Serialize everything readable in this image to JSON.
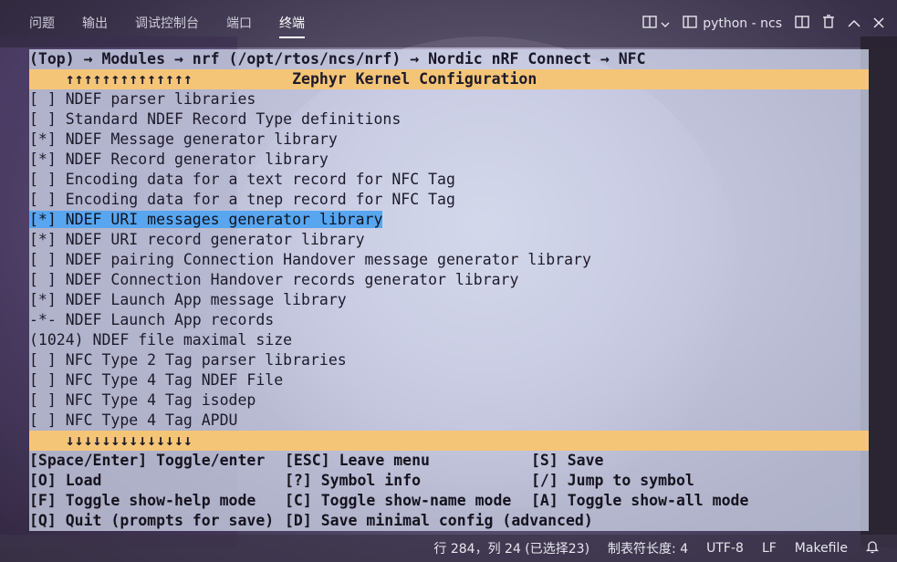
{
  "tabs": [
    "问题",
    "输出",
    "调试控制台",
    "端口",
    "终端"
  ],
  "active_tab_index": 4,
  "terminal_name": "python - ncs",
  "breadcrumb": "(Top) → Modules → nrf (/opt/rtos/ncs/nrf) → Nordic nRF Connect → NFC",
  "title_line": "    ↑↑↑↑↑↑↑↑↑↑↑↑↑↑           Zephyr Kernel Configuration",
  "menu_items": [
    "[ ] NDEF parser libraries",
    "[ ] Standard NDEF Record Type definitions",
    "[*] NDEF Message generator library",
    "[*] NDEF Record generator library",
    "[ ] Encoding data for a text record for NFC Tag",
    "[ ] Encoding data for a tnep record for NFC Tag",
    "[*] NDEF URI messages generator library",
    "[*] NDEF URI record generator library",
    "[ ] NDEF pairing Connection Handover message generator library",
    "[ ] NDEF Connection Handover records generator library",
    "[*] NDEF Launch App message library",
    "-*- NDEF Launch App records",
    "(1024) NDEF file maximal size",
    "[ ] NFC Type 2 Tag parser libraries",
    "[ ] NFC Type 4 Tag NDEF File",
    "[ ] NFC Type 4 Tag isodep",
    "[ ] NFC Type 4 Tag APDU"
  ],
  "selected_index": 6,
  "bottom_arrows": "    ↓↓↓↓↓↓↓↓↓↓↓↓↓↓",
  "keys": [
    [
      "[Space/Enter] Toggle/enter",
      "[ESC] Leave menu",
      "[S] Save"
    ],
    [
      "[O] Load",
      "[?] Symbol info",
      "[/] Jump to symbol"
    ],
    [
      "[F] Toggle show-help mode",
      "[C] Toggle show-name mode",
      "[A] Toggle show-all mode"
    ],
    [
      "[Q] Quit (prompts for save)",
      "[D] Save minimal config (advanced)",
      ""
    ]
  ],
  "status": {
    "position": "行 284，列 24 (已选择23)",
    "tab_size": "制表符长度: 4",
    "encoding": "UTF-8",
    "eol": "LF",
    "language": "Makefile"
  },
  "icons": {
    "panel_layout": "terminal-icon",
    "dropdown": "chevron-down-icon",
    "split": "split-icon",
    "trash": "trash-icon",
    "maximize": "chevron-up-icon",
    "close": "close-icon",
    "bell": "bell-icon"
  },
  "colors": {
    "highlight_bar": "#f5c577",
    "selection": "#58a6f0"
  }
}
